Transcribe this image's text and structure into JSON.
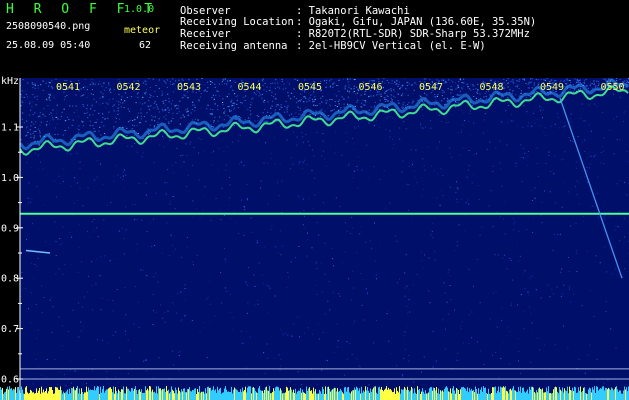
{
  "app": {
    "name": "H R O F F T",
    "version": "1.0.0"
  },
  "file_name": "2508090540.png",
  "datetime": "25.08.09 05:40",
  "meteor": {
    "label": "meteor",
    "count": "62"
  },
  "info": [
    {
      "label": "Observer",
      "value": ": Takanori Kawachi"
    },
    {
      "label": "Receiving Location",
      "value": ": Ogaki, Gifu, JAPAN (136.60E, 35.35N)"
    },
    {
      "label": "Receiver",
      "value": ": R820T2(RTL-SDR) SDR-Sharp 53.372MHz"
    },
    {
      "label": "Receiving antenna",
      "value": ": 2el-HB9CV Vertical (el. E-W)"
    }
  ],
  "spectrogram": {
    "y_unit": "kHz",
    "y_ticks": [
      "1.1",
      "1.0",
      "0.9",
      "0.8",
      "0.7",
      "0.6"
    ],
    "y_tick_values": [
      1.1,
      1.0,
      0.9,
      0.8,
      0.7,
      0.6
    ],
    "y_range": [
      0.59,
      1.2
    ],
    "time_labels": [
      "0541",
      "0542",
      "0543",
      "0544",
      "0545",
      "0546",
      "0547",
      "0548",
      "0549",
      "0550"
    ],
    "colors": {
      "background": "#00106a",
      "signal": "#4cff9a",
      "noise_bar": "#33ccff",
      "axis": "#ffffff",
      "tick_label": "#ffff55"
    }
  }
}
